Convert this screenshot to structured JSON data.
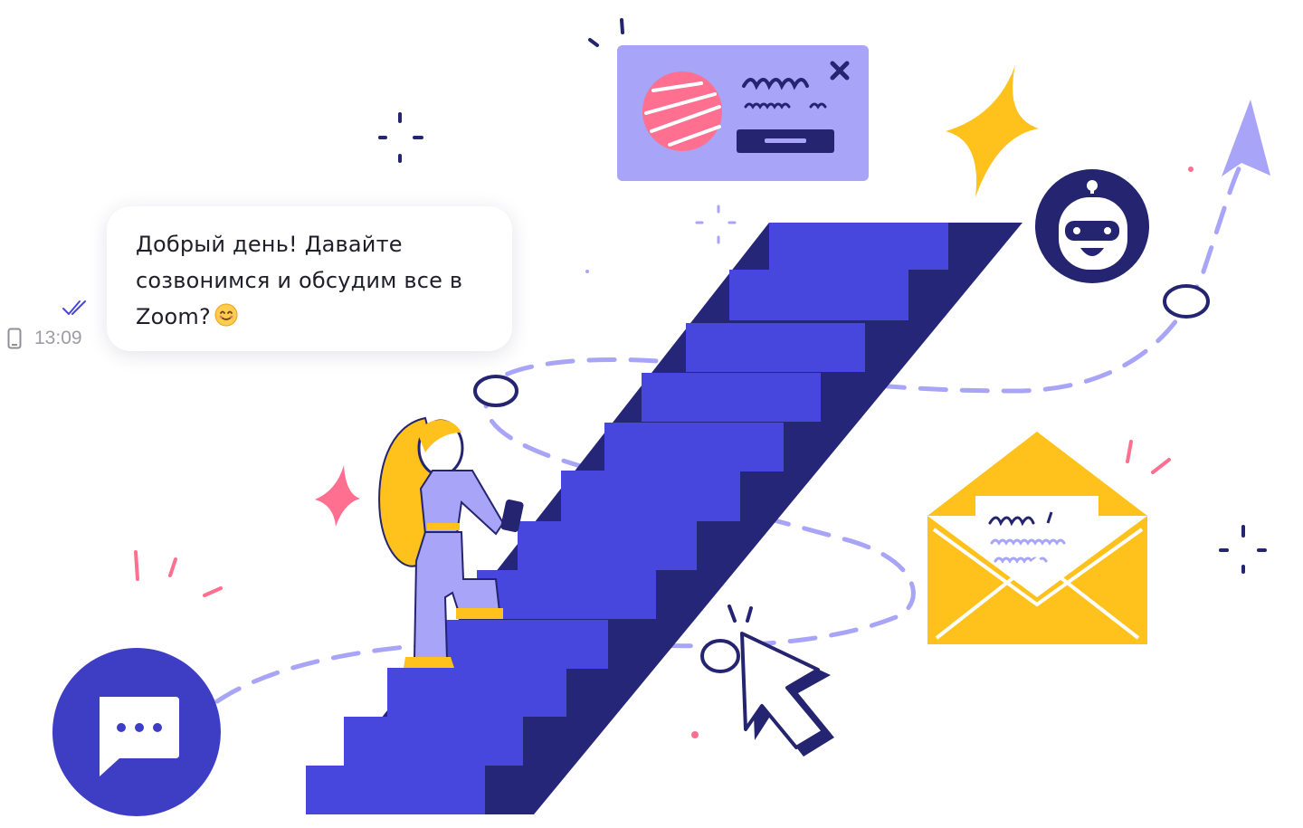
{
  "chat": {
    "message_lines": [
      "Добрый день! Давайте",
      "созвонимся и обсудим все в",
      "Zoom?"
    ],
    "emoji": "😊",
    "time": "13:09"
  },
  "icons": {
    "read_status": "double-check-icon",
    "device": "phone-icon",
    "launcher": "chat-bubble-dots-icon",
    "popup_close": "close-icon",
    "robot": "robot-icon",
    "email": "envelope-icon",
    "cursor": "cursor-arrow-icon"
  },
  "colors": {
    "stair_front": "#4747de",
    "stair_side": "#262678",
    "navy": "#242470",
    "lavender": "#a8a4f7",
    "yellow": "#ffc21c",
    "pink": "#ff6f8f",
    "launcher": "#3d3ec4"
  }
}
